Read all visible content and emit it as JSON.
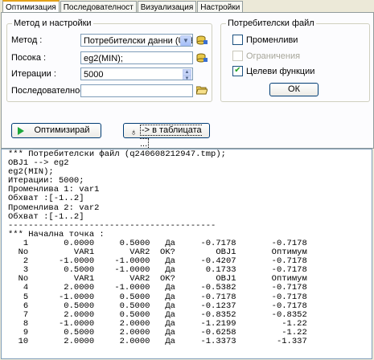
{
  "tabs": [
    {
      "label": "Оптимизация",
      "active": true
    },
    {
      "label": "Последователност",
      "active": false
    },
    {
      "label": "Визуализация",
      "active": false
    },
    {
      "label": "Настройки",
      "active": false
    }
  ],
  "method_group": {
    "title": "Метод и настройки",
    "method_label": "Метод :",
    "method_value": "Потребителски данни (USERFI",
    "direction_label": "Посока :",
    "direction_value": "eg2(MIN);",
    "iterations_label": "Итерации :",
    "iterations_value": "5000",
    "sequence_label": "Последователност :",
    "sequence_value": ""
  },
  "user_file_group": {
    "title": "Потребителски файл",
    "variables_label": "Променливи",
    "variables_checked": false,
    "constraints_label": "Ограничения",
    "constraints_checked": false,
    "objectives_label": "Целеви функции",
    "objectives_checked": true,
    "ok_label": "ОК"
  },
  "actions": {
    "optimize_label": "Оптимизирай",
    "to_table_label": "-> в таблицата ..."
  },
  "output_lines": [
    "*** Потребителски файл (q240608212947.tmp);",
    "OBJ1 --> eg2",
    "eg2(MIN);",
    "Итерации: 5000;",
    "Променлива 1: var1",
    "Обхват :[-1..2]",
    "Променлива 2: var2",
    "Обхват :[-1..2]",
    "-----------------------------------------",
    "*** Начална точка :",
    "   1       0.0000     0.5000   Да     -0.7178       -0.7178",
    "  No         VAR1       VAR2  OK?        OBJ1       Оптимум",
    "   2      -1.0000    -1.0000   Да     -0.4207       -0.7178",
    "   3       0.5000    -1.0000   Да      0.1733       -0.7178",
    "  No         VAR1       VAR2  OK?        OBJ1       Оптимум",
    "   4       2.0000    -1.0000   Да     -0.5382       -0.7178",
    "   5      -1.0000     0.5000   Да     -0.7178       -0.7178",
    "   6       0.5000     0.5000   Да     -0.1237       -0.7178",
    "   7       2.0000     0.5000   Да     -0.8352       -0.8352",
    "   8      -1.0000     2.0000   Да     -1.2199         -1.22",
    "   9       0.5000     2.0000   Да     -0.6258         -1.22",
    "  10       2.0000     2.0000   Да     -1.3373        -1.337"
  ]
}
